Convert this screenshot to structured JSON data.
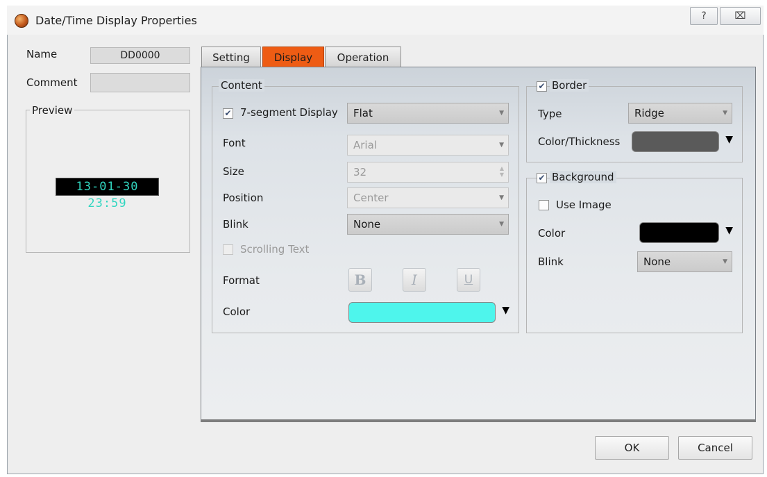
{
  "window": {
    "title": "Date/Time Display Properties",
    "help_glyph": "?",
    "close_glyph": "⌧"
  },
  "left": {
    "name_label": "Name",
    "name_value": "DD0000",
    "comment_label": "Comment",
    "comment_value": "",
    "preview_label": "Preview",
    "preview_text": "13-01-30 23:59"
  },
  "tabs": [
    {
      "label": "Setting",
      "active": false
    },
    {
      "label": "Display",
      "active": true
    },
    {
      "label": "Operation",
      "active": false
    }
  ],
  "content": {
    "legend": "Content",
    "seven_segment_label": "7-segment Display",
    "seven_segment_checked": true,
    "seven_segment_value": "Flat",
    "font_label": "Font",
    "font_value": "Arial",
    "size_label": "Size",
    "size_value": "32",
    "position_label": "Position",
    "position_value": "Center",
    "blink_label": "Blink",
    "blink_value": "None",
    "scrolling_label": "Scrolling Text",
    "scrolling_checked": false,
    "format_label": "Format",
    "bold_glyph": "B",
    "italic_glyph": "I",
    "underline_glyph": "U",
    "color_label": "Color",
    "color_value": "#4ef5ec"
  },
  "border": {
    "legend": "Border",
    "checked": true,
    "type_label": "Type",
    "type_value": "Ridge",
    "color_label": "Color/Thickness",
    "color_value": "#5a5a5a"
  },
  "background": {
    "legend": "Background",
    "checked": true,
    "use_image_label": "Use Image",
    "use_image_checked": false,
    "color_label": "Color",
    "color_value": "#000000",
    "blink_label": "Blink",
    "blink_value": "None"
  },
  "buttons": {
    "ok": "OK",
    "cancel": "Cancel"
  },
  "colors": {
    "active_tab": "#ee5c14",
    "segment_text": "#32d6c0"
  }
}
